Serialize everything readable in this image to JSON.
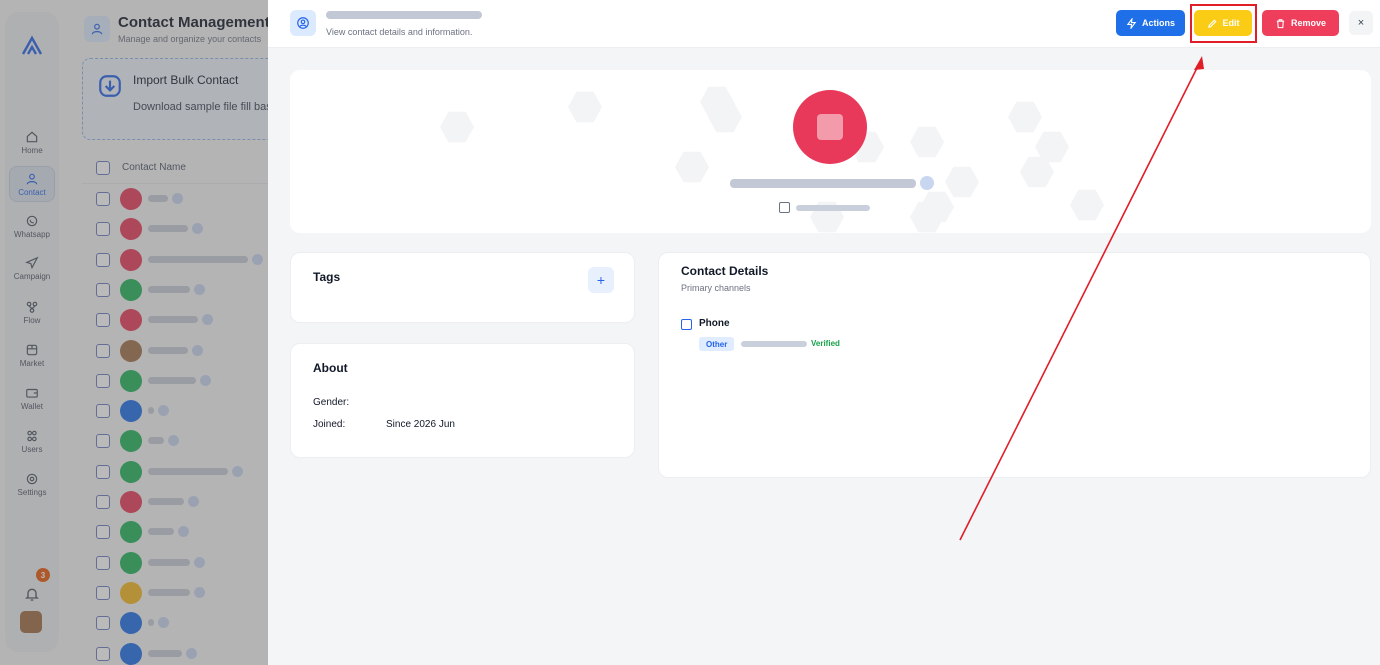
{
  "nav": {
    "items": [
      {
        "label": "Home",
        "icon": "home-icon"
      },
      {
        "label": "Contact",
        "icon": "contact-icon",
        "active": true
      },
      {
        "label": "Whatsapp",
        "icon": "whatsapp-icon"
      },
      {
        "label": "Campaign",
        "icon": "send-icon"
      },
      {
        "label": "Flow",
        "icon": "flow-icon"
      },
      {
        "label": "Market",
        "icon": "store-icon"
      },
      {
        "label": "Wallet",
        "icon": "wallet-icon"
      },
      {
        "label": "Users",
        "icon": "users-icon"
      },
      {
        "label": "Settings",
        "icon": "settings-icon"
      }
    ],
    "notification_count": "3"
  },
  "contact_list": {
    "title": "Contact Management",
    "subtitle": "Manage and organize your contacts",
    "import": {
      "title": "Import Bulk Contact",
      "subtitle": "Download sample file fill based"
    },
    "column_header": "Contact Name"
  },
  "detail": {
    "header_subtitle": "View contact details and information.",
    "actions_label": "Actions",
    "edit_label": "Edit",
    "remove_label": "Remove",
    "close_label": "×",
    "tags": {
      "title": "Tags",
      "add_label": "+"
    },
    "about": {
      "title": "About",
      "gender_label": "Gender:",
      "gender_value": "",
      "joined_label": "Joined:",
      "joined_value": "Since 2026 Jun"
    },
    "contact_details": {
      "title": "Contact Details",
      "subtitle": "Primary channels",
      "phone_label": "Phone",
      "phone_type": "Other",
      "phone_status": "Verified"
    }
  },
  "colors": {
    "primary": "#1e6fe8",
    "edit": "#facc15",
    "remove": "#ef3e5c",
    "verified": "#16a34a",
    "annotation": "#e11d28"
  }
}
